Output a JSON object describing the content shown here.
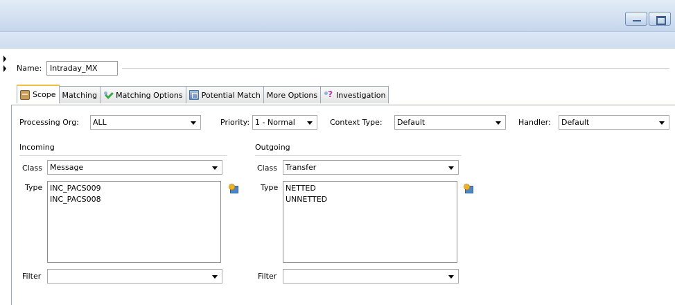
{
  "form": {
    "name_label": "Name:",
    "name_value": "Intraday_MX"
  },
  "tabs": [
    {
      "label": "Scope",
      "icon": "box-icon",
      "active": true
    },
    {
      "label": "Matching",
      "icon": null
    },
    {
      "label": "Matching Options",
      "icon": "match-check-icon"
    },
    {
      "label": "Potential Match",
      "icon": "grid-icon"
    },
    {
      "label": "More Options",
      "icon": null
    },
    {
      "label": "Investigation",
      "icon": "question-icon"
    }
  ],
  "scope": {
    "processing_org_label": "Processing Org:",
    "processing_org_value": "ALL",
    "priority_label": "Priority:",
    "priority_value": "1 - Normal",
    "context_type_label": "Context Type:",
    "context_type_value": "Default",
    "handler_label": "Handler:",
    "handler_value": "Default",
    "incoming": {
      "title": "Incoming",
      "class_label": "Class",
      "class_value": "Message",
      "type_label": "Type",
      "types": [
        "INC_PACS009",
        "INC_PACS008"
      ],
      "filter_label": "Filter",
      "filter_value": ""
    },
    "outgoing": {
      "title": "Outgoing",
      "class_label": "Class",
      "class_value": "Transfer",
      "type_label": "Type",
      "types": [
        "NETTED",
        "UNNETTED"
      ],
      "filter_label": "Filter",
      "filter_value": ""
    }
  },
  "colors": {
    "active_tab_accent": "#f2c044",
    "titlebar": "#c5d6ec"
  }
}
